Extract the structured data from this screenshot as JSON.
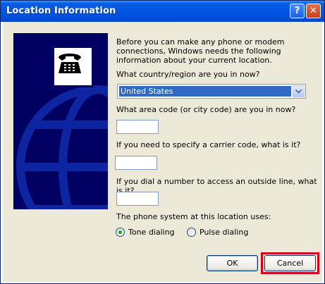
{
  "window": {
    "title": "Location Information",
    "help_label": "?",
    "close_label": "✕"
  },
  "content": {
    "intro": "Before you can make any phone or modem connections, Windows needs the following information about your current location.",
    "country_question": "What country/region are you in now?",
    "country_value": "United States",
    "area_code_question": "What area code (or city code) are you in now?",
    "carrier_code_question": "If you need to specify a carrier code, what is it?",
    "outside_line_question": "If you dial a number to access an outside line, what is it?",
    "phone_system_label": "The phone system at this location uses:",
    "tone_label": "Tone dialing",
    "pulse_label": "Pulse dialing",
    "selected_dialing": "tone"
  },
  "buttons": {
    "ok": "OK",
    "cancel": "Cancel"
  },
  "colors": {
    "side_panel": "#000062",
    "highlight": "#d4001c",
    "selection": "#316ac5"
  }
}
